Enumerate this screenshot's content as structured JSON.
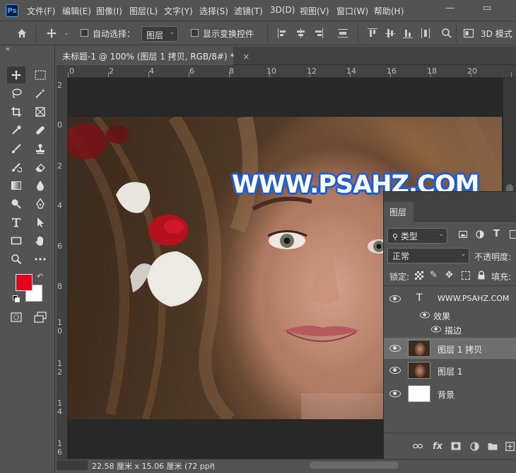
{
  "app": {
    "logo": "Ps"
  },
  "menu": [
    "文件(F)",
    "编辑(E)",
    "图像(I)",
    "图层(L)",
    "文字(Y)",
    "选择(S)",
    "滤镜(T)",
    "3D(D)",
    "视图(V)",
    "窗口(W)",
    "帮助(H)"
  ],
  "window_controls": {
    "minimize": "—",
    "restore": "▭"
  },
  "options": {
    "auto_select_label": "自动选择：",
    "auto_select_value": "图层",
    "show_transform_label": "显示变换控件",
    "mode_3d_label": "3D 模式"
  },
  "document": {
    "tab_title": "未标题-1 @ 100% (图层 1 拷贝, RGB/8#) *",
    "close_glyph": "×",
    "status": "22.58 厘米 x 15.06 厘米 (72 ppi)",
    "ruler_top": [
      "0",
      "2",
      "4",
      "6",
      "8",
      "10",
      "12",
      "14",
      "16",
      "18",
      "20"
    ],
    "ruler_left": [
      "2",
      "0",
      "2",
      "4",
      "6",
      "8",
      "1 0",
      "1 2",
      "1 4",
      "1 6"
    ],
    "watermark_text": "WWW.PSAHZ.COM"
  },
  "colors": {
    "foreground": "#e3001b",
    "background": "#ffffff",
    "stroke": "#1e5fd8"
  },
  "layers_panel": {
    "tab": "图层",
    "filter_kind": "类型",
    "blend_mode": "正常",
    "opacity_label": "不透明度:",
    "lock_label": "锁定:",
    "fill_label": "填充:",
    "layers": [
      {
        "name": "WWW.PSAHZ.COM",
        "type": "text",
        "type_glyph": "T",
        "selected": false
      },
      {
        "name": "效果",
        "type": "effects",
        "selected": false
      },
      {
        "name": "描边",
        "type": "effect-item",
        "selected": false
      },
      {
        "name": "图层 1 拷贝",
        "type": "image",
        "selected": true
      },
      {
        "name": "图层 1",
        "type": "image",
        "selected": false
      },
      {
        "name": "背景",
        "type": "background",
        "selected": false
      }
    ]
  }
}
